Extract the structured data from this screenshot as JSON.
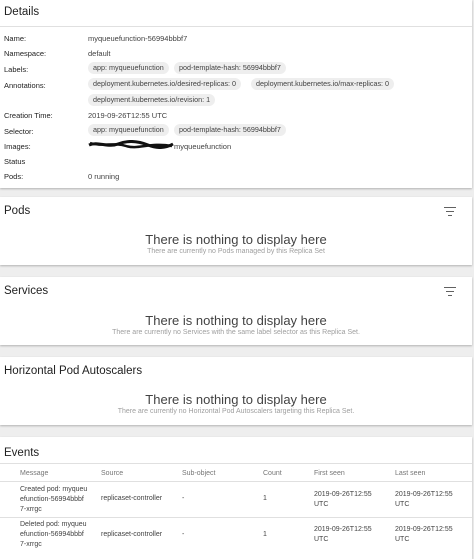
{
  "details": {
    "title": "Details",
    "name_label": "Name:",
    "name_value": "myqueuefunction-56994bbbf7",
    "namespace_label": "Namespace:",
    "namespace_value": "default",
    "labels_label": "Labels:",
    "labels_chips": [
      "app: myqueuefunction",
      "pod-template-hash: 56994bbbf7"
    ],
    "annotations_label": "Annotations:",
    "annotations_chips": [
      "deployment.kubernetes.io/desired-replicas: 0",
      "deployment.kubernetes.io/max-replicas: 0",
      "deployment.kubernetes.io/revision: 1"
    ],
    "creation_label": "Creation Time:",
    "creation_value": "2019-09-26T12:55 UTC",
    "selector_label": "Selector:",
    "selector_chips": [
      "app: myqueuefunction",
      "pod-template-hash: 56994bbbf7"
    ],
    "images_label": "Images:",
    "images_value_suffix": "myqueuefunction",
    "status_label": "Status",
    "pods_label": "Pods:",
    "pods_value": "0 running"
  },
  "pods": {
    "title": "Pods",
    "empty_title": "There is nothing to display here",
    "empty_sub": "There are currently no Pods managed by this Replica Set"
  },
  "services": {
    "title": "Services",
    "empty_title": "There is nothing to display here",
    "empty_sub": "There are currently no Services with the same label selector as this Replica Set."
  },
  "hpa": {
    "title": "Horizontal Pod Autoscalers",
    "empty_title": "There is nothing to display here",
    "empty_sub": "There are currently no Horizontal Pod Autoscalers targeting this Replica Set."
  },
  "events": {
    "title": "Events",
    "headers": [
      "Message",
      "Source",
      "Sub-object",
      "Count",
      "First seen",
      "Last seen"
    ],
    "rows": [
      {
        "message_l1": "Created pod: myqueu",
        "message_l2": "efunction-56994bbbf",
        "message_l3": "7-xrrgc",
        "source": "replicaset-controller",
        "subobject": "-",
        "count": "1",
        "first_l1": "2019-09-26T12:55",
        "first_l2": "UTC",
        "last_l1": "2019-09-26T12:55",
        "last_l2": "UTC"
      },
      {
        "message_l1": "Deleted pod: myqueu",
        "message_l2": "efunction-56994bbbf",
        "message_l3": "7-xrrgc",
        "source": "replicaset-controller",
        "subobject": "-",
        "count": "1",
        "first_l1": "2019-09-26T12:55",
        "first_l2": "UTC",
        "last_l1": "2019-09-26T12:55",
        "last_l2": "UTC"
      }
    ]
  }
}
